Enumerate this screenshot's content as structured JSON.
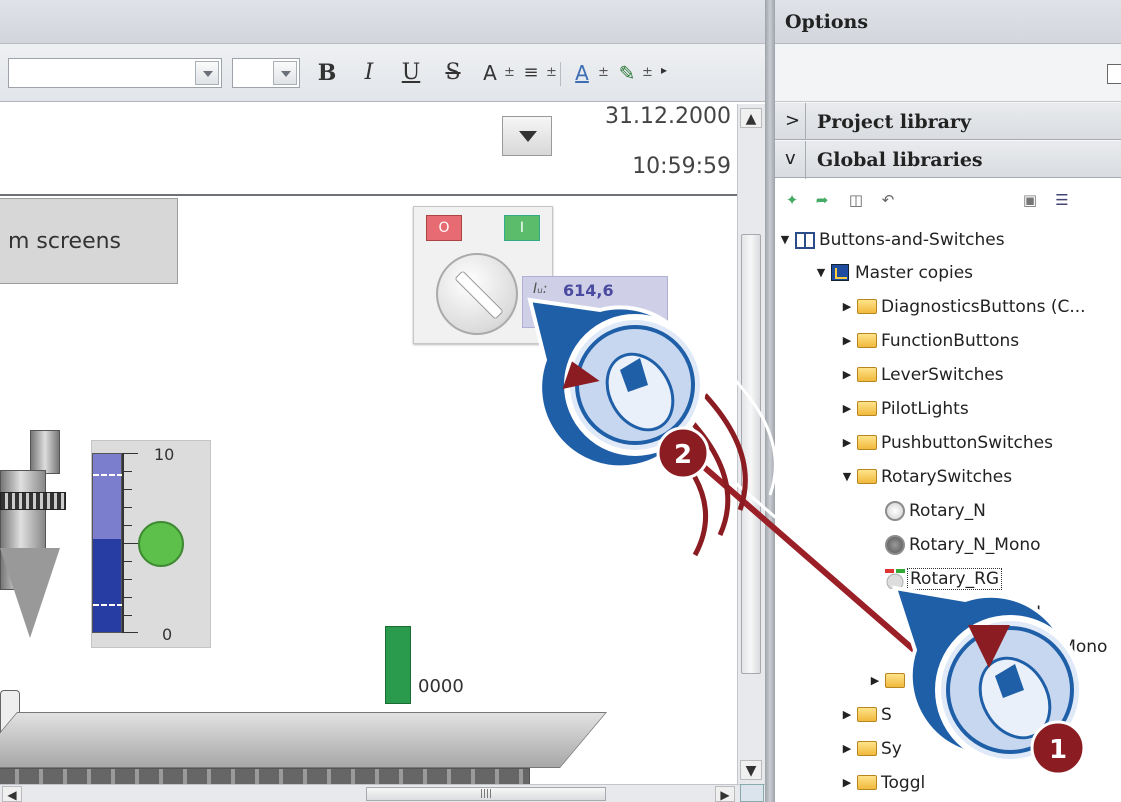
{
  "pane": {
    "title": "Options",
    "project_library": "Project library",
    "global_libraries": "Global libraries",
    "project_chevron": ">",
    "global_chevron": "v"
  },
  "toolbar": {
    "bold": "B",
    "italic": "I",
    "underline": "U",
    "strike": "S",
    "grow_font": "A",
    "plus_minus": "±"
  },
  "content": {
    "date": "31.12.2000",
    "time": "10:59:59",
    "screens_button": "m screens"
  },
  "rotary_widget": {
    "off_label": "O",
    "on_label": "I",
    "value_prefix": "Iᵤ:",
    "value": "614,6"
  },
  "gauge": {
    "max_label": "10",
    "min_label": "0",
    "fill_fraction": 0.52
  },
  "counter": "0000",
  "tree": {
    "root": "Buttons-and-Switches",
    "master_copies": "Master copies",
    "folders": [
      "DiagnosticsButtons (C...",
      "FunctionButtons",
      "LeverSwitches",
      "PilotLights",
      "PushbuttonSwitches",
      "RotarySwitches"
    ],
    "rotary_items": [
      "Rotary_N",
      "Rotary_N_Mono",
      "Rotary_RG"
    ],
    "partial_items": [
      "...GN",
      "...Mono",
      "S",
      "Sy",
      "Toggl"
    ]
  },
  "callouts": [
    {
      "number": "1"
    },
    {
      "number": "2"
    }
  ],
  "colors": {
    "callout_ring": "#1f5fa8",
    "callout_badge": "#8b1c22",
    "gauge_fill": "#273da4",
    "led": "#5cc04b"
  }
}
